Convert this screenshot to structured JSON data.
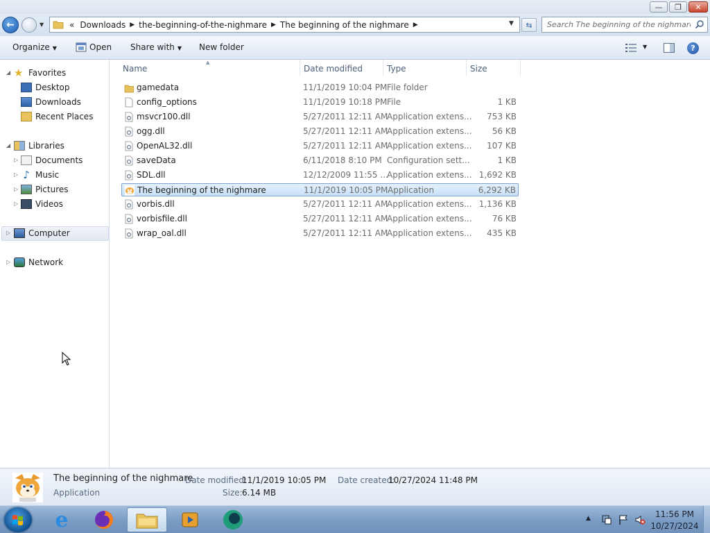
{
  "window": {
    "controls": {
      "minimize": "—",
      "maximize": "❐",
      "close": "✕"
    }
  },
  "address": {
    "overflow": "«",
    "crumbs": [
      "Downloads",
      "the-beginning-of-the-nighmare",
      "The beginning of the nighmare"
    ]
  },
  "search": {
    "placeholder": "Search The beginning of the nighmare"
  },
  "toolbar": {
    "organize": "Organize",
    "open": "Open",
    "share": "Share with",
    "new_folder": "New folder"
  },
  "nav": {
    "favorites": "Favorites",
    "desktop": "Desktop",
    "downloads": "Downloads",
    "recent": "Recent Places",
    "libraries": "Libraries",
    "documents": "Documents",
    "music": "Music",
    "pictures": "Pictures",
    "videos": "Videos",
    "computer": "Computer",
    "network": "Network"
  },
  "columns": {
    "name": "Name",
    "date": "Date modified",
    "type": "Type",
    "size": "Size"
  },
  "files": [
    {
      "name": "gamedata",
      "date": "11/1/2019 10:04 PM",
      "type": "File folder",
      "size": "",
      "icon": "folder-icon"
    },
    {
      "name": "config_options",
      "date": "11/1/2019 10:18 PM",
      "type": "File",
      "size": "1 KB",
      "icon": "file-icon"
    },
    {
      "name": "msvcr100.dll",
      "date": "5/27/2011 12:11 AM",
      "type": "Application extens...",
      "size": "753 KB",
      "icon": "dll-icon"
    },
    {
      "name": "ogg.dll",
      "date": "5/27/2011 12:11 AM",
      "type": "Application extens...",
      "size": "56 KB",
      "icon": "dll-icon"
    },
    {
      "name": "OpenAL32.dll",
      "date": "5/27/2011 12:11 AM",
      "type": "Application extens...",
      "size": "107 KB",
      "icon": "dll-icon"
    },
    {
      "name": "saveData",
      "date": "6/11/2018 8:10 PM",
      "type": "Configuration sett...",
      "size": "1 KB",
      "icon": "config-icon"
    },
    {
      "name": "SDL.dll",
      "date": "12/12/2009 11:55 ...",
      "type": "Application extens...",
      "size": "1,692 KB",
      "icon": "dll-icon"
    },
    {
      "name": "The beginning of the nighmare",
      "date": "11/1/2019 10:05 PM",
      "type": "Application",
      "size": "6,292 KB",
      "icon": "app-icon",
      "selected": true
    },
    {
      "name": "vorbis.dll",
      "date": "5/27/2011 12:11 AM",
      "type": "Application extens...",
      "size": "1,136 KB",
      "icon": "dll-icon"
    },
    {
      "name": "vorbisfile.dll",
      "date": "5/27/2011 12:11 AM",
      "type": "Application extens...",
      "size": "76 KB",
      "icon": "dll-icon"
    },
    {
      "name": "wrap_oal.dll",
      "date": "5/27/2011 12:11 AM",
      "type": "Application extens...",
      "size": "435 KB",
      "icon": "dll-icon"
    }
  ],
  "details": {
    "name": "The beginning of the nighmare",
    "type": "Application",
    "modified_label": "Date modified:",
    "modified_value": "11/1/2019 10:05 PM",
    "created_label": "Date created:",
    "created_value": "10/27/2024 11:48 PM",
    "size_label": "Size:",
    "size_value": "6.14 MB"
  },
  "taskbar": {
    "time": "11:56 PM",
    "date": "10/27/2024",
    "tray_expand": "▲"
  }
}
